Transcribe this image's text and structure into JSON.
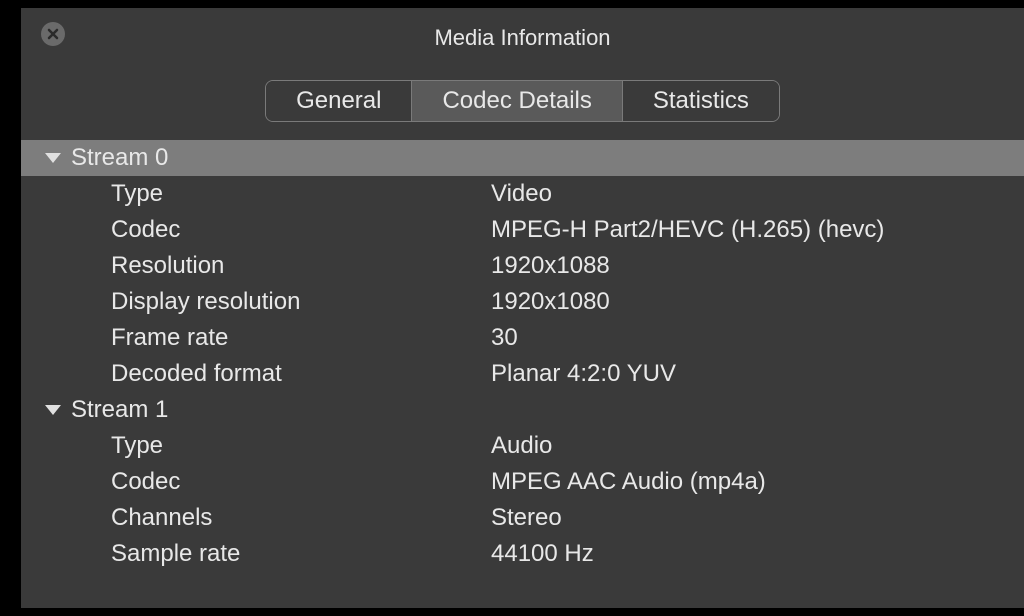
{
  "window": {
    "title": "Media Information"
  },
  "tabs": {
    "general": "General",
    "codec_details": "Codec Details",
    "statistics": "Statistics"
  },
  "streams": [
    {
      "header": "Stream 0",
      "highlighted": true,
      "rows": [
        {
          "label": "Type",
          "value": "Video"
        },
        {
          "label": "Codec",
          "value": "MPEG-H Part2/HEVC (H.265) (hevc)"
        },
        {
          "label": "Resolution",
          "value": "1920x1088"
        },
        {
          "label": "Display resolution",
          "value": "1920x1080"
        },
        {
          "label": "Frame rate",
          "value": "30"
        },
        {
          "label": "Decoded format",
          "value": "Planar 4:2:0 YUV"
        }
      ]
    },
    {
      "header": "Stream 1",
      "highlighted": false,
      "rows": [
        {
          "label": "Type",
          "value": "Audio"
        },
        {
          "label": "Codec",
          "value": "MPEG AAC Audio (mp4a)"
        },
        {
          "label": "Channels",
          "value": "Stereo"
        },
        {
          "label": "Sample rate",
          "value": "44100 Hz"
        }
      ]
    }
  ]
}
